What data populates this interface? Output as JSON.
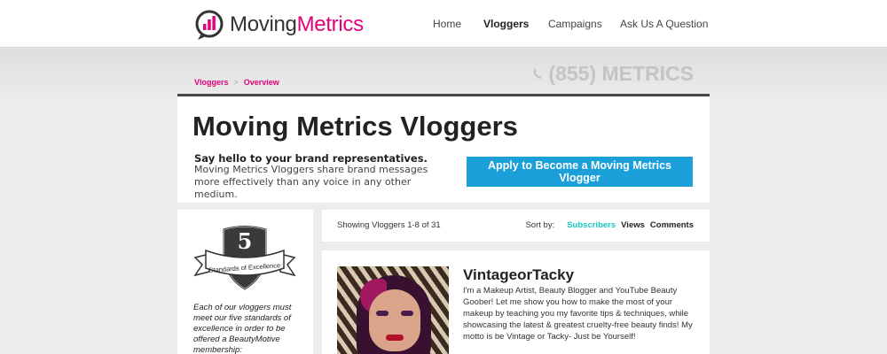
{
  "header": {
    "logo": {
      "word1": "Moving",
      "word2": "Metrics"
    },
    "nav": [
      {
        "label": "Home",
        "active": false
      },
      {
        "label": "Vloggers",
        "active": true
      },
      {
        "label": "Campaigns",
        "active": false
      },
      {
        "label": "Ask Us A Question",
        "active": false
      }
    ]
  },
  "breadcrumb": {
    "items": [
      "Vloggers",
      "Overview"
    ],
    "separator": ">"
  },
  "phone": {
    "icon": "phone-icon",
    "text": "(855) METRICS"
  },
  "hero": {
    "title": "Moving Metrics Vloggers",
    "lead": "Say hello to your brand representatives.",
    "description": "Moving Metrics Vloggers share brand messages more effectively than any voice in any other medium.",
    "cta_label": "Apply to Become a Moving Metrics Vlogger"
  },
  "sidebar": {
    "badge": {
      "number": "5",
      "ribbon_text": "Standards of Excellence"
    },
    "text": "Each of our vloggers must meet our five standards of excellence in order to be offered a BeautyMotive membership:"
  },
  "list": {
    "showing": "Showing Vloggers 1-8 of 31",
    "sort_label": "Sort by:",
    "sort_options": [
      {
        "label": "Subscribers",
        "active": true
      },
      {
        "label": "Views",
        "active": false
      },
      {
        "label": "Comments",
        "active": false
      }
    ]
  },
  "vloggers": [
    {
      "name": "VintageorTacky",
      "bio": "I'm a Makeup Artist, Beauty Blogger and YouTube Beauty Goober! Let me show you how to make the most of your makeup by teaching you my favorite tips & techniques, while showcasing the latest & greatest cruelty-free beauty finds! My motto is be Vintage or Tacky- Just be Yourself!"
    }
  ],
  "colors": {
    "brand_magenta": "#e3007b",
    "cta_blue": "#1a9fd8",
    "sort_active": "#1bc5c5",
    "phone_gray": "#c4c4c4"
  }
}
